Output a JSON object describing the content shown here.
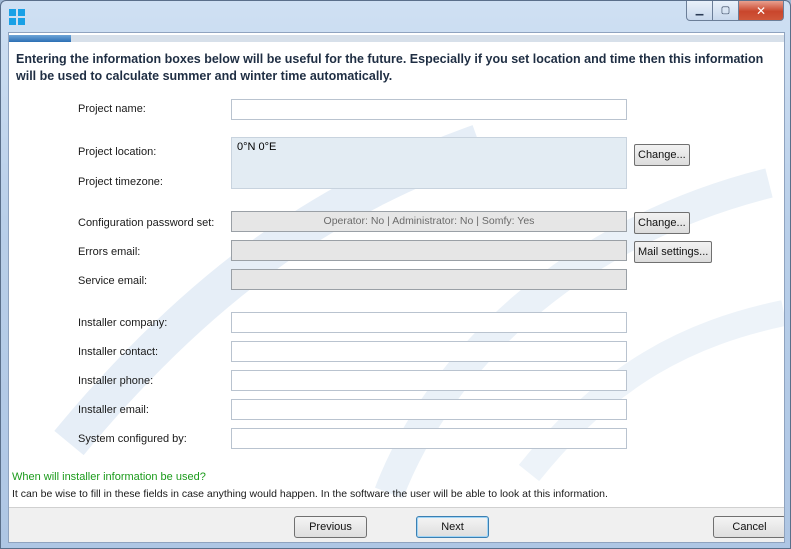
{
  "window": {
    "controls": {
      "minimize": "▁",
      "maximize": "▢",
      "close": "✕"
    }
  },
  "progress": {
    "value": 0.08,
    "color": "#2b6fb4"
  },
  "intro_text": "Entering the information boxes below will be useful for the future. Especially if you set location and time then this information will be used to calculate summer and winter time automatically.",
  "fields": {
    "project_name": {
      "label": "Project name:",
      "value": ""
    },
    "project_location": {
      "label": "Project location:",
      "value": "0°N 0°E"
    },
    "project_timezone": {
      "label": "Project timezone:"
    },
    "config_password": {
      "label": "Configuration password set:",
      "value": "Operator: No |  Administrator: No | Somfy: Yes"
    },
    "errors_email": {
      "label": "Errors email:",
      "value": ""
    },
    "service_email": {
      "label": "Service email:",
      "value": ""
    },
    "installer_company": {
      "label": "Installer company:",
      "value": ""
    },
    "installer_contact": {
      "label": "Installer contact:",
      "value": ""
    },
    "installer_phone": {
      "label": "Installer phone:",
      "value": ""
    },
    "installer_email": {
      "label": "Installer email:",
      "value": ""
    },
    "system_configured_by": {
      "label": "System configured by:",
      "value": ""
    }
  },
  "buttons": {
    "change_location": "Change...",
    "change_password": "Change...",
    "mail_settings": "Mail settings...",
    "previous": "Previous",
    "next": "Next",
    "cancel": "Cancel"
  },
  "info": {
    "title": "When will installer information be used?",
    "text": "It can be wise to fill in these fields in case anything would happen. In the software the user will be able to look at this information."
  },
  "colors": {
    "accent": "#2b6fb4",
    "info_green": "#1b9b1b",
    "close_red": "#c9462c"
  }
}
